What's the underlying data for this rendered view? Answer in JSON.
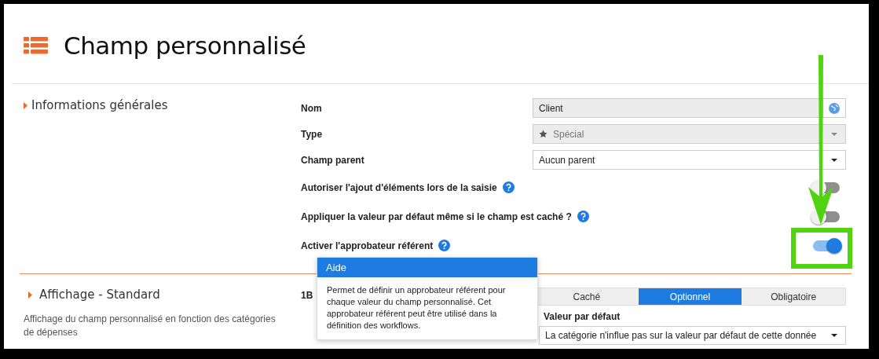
{
  "header": {
    "title": "Champ personnalisé"
  },
  "general": {
    "title": "Informations générales",
    "fields": [
      {
        "kind": "text",
        "label": "Nom",
        "value": "Client",
        "disabled": true
      },
      {
        "kind": "type-select",
        "label": "Type",
        "value": "Spécial",
        "disabled": true
      },
      {
        "kind": "select",
        "label": "Champ parent",
        "value": "Aucun parent",
        "disabled": false
      }
    ],
    "toggles": [
      {
        "label": "Autoriser l'ajout d'éléments lors de la saisie",
        "on": false
      },
      {
        "label": "Appliquer la valeur par défaut même si le champ est caché ?",
        "on": false
      },
      {
        "label": "Activer l'approbateur référent",
        "on": true
      }
    ]
  },
  "tooltip": {
    "title": "Aide",
    "text": "Permet de définir un approbateur référent pour chaque valeur du champ personnalisé. Cet approbateur référent peut être utilisé dans la définition des workflows."
  },
  "display": {
    "title": "Affichage - Standard",
    "description": "Affichage du champ personnalisé en fonction des catégories de dépenses",
    "row_label": "1B",
    "modes": [
      {
        "label": "Caché",
        "selected": false
      },
      {
        "label": "Optionnel",
        "selected": true
      },
      {
        "label": "Obligatoire",
        "selected": false
      }
    ],
    "default_label": "Valeur par défaut",
    "default_value": "La catégorie n'influe pas sur la valeur par défaut de cette donnée"
  }
}
